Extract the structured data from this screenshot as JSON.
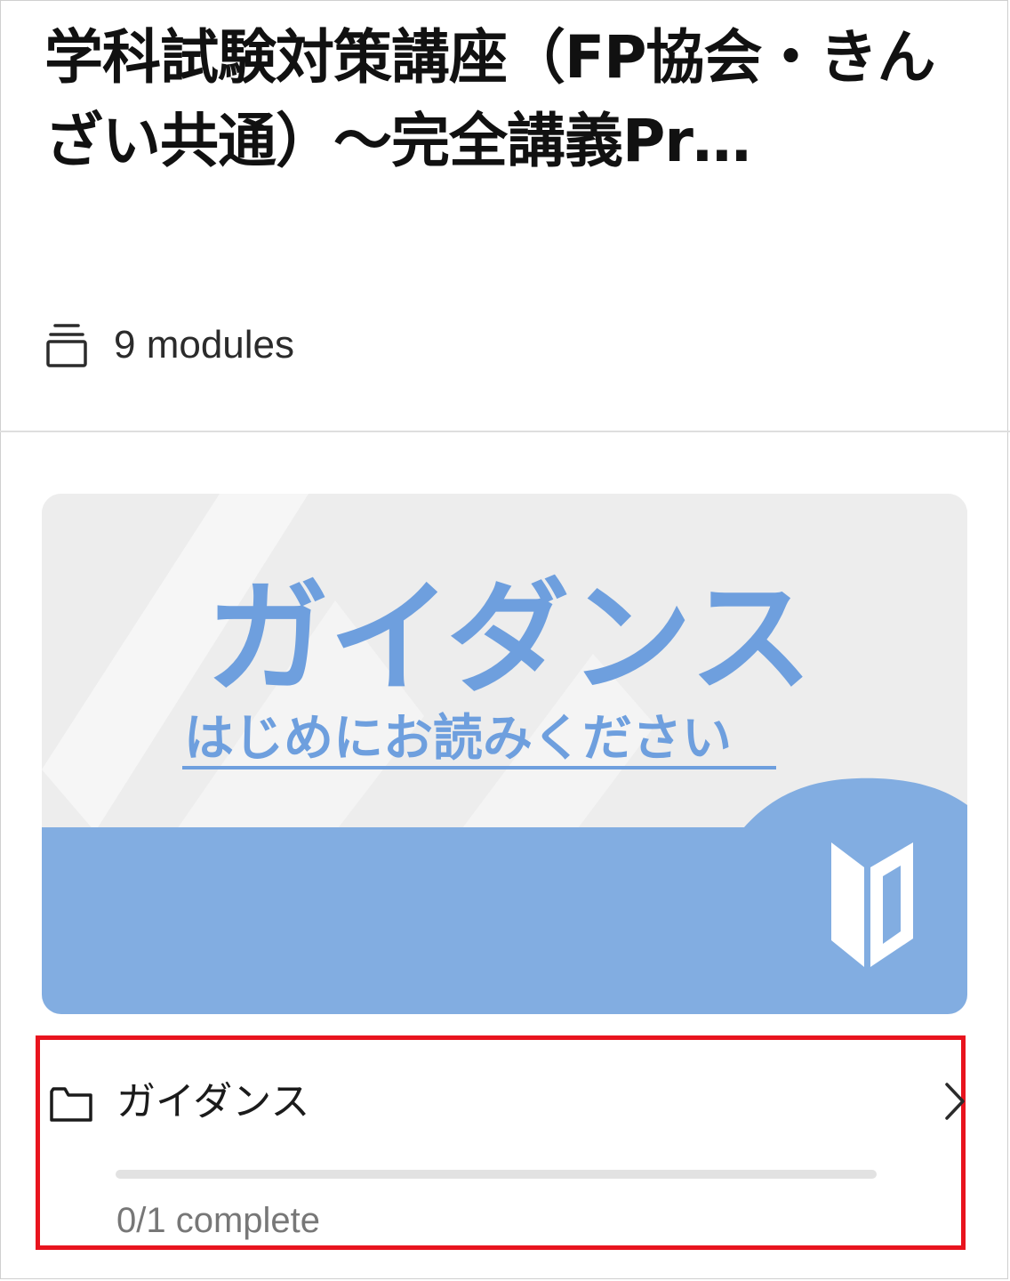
{
  "course": {
    "title": "学科試験対策講座（FP協会・きんざい共通）～完全講義Pr…",
    "modules_count": "9 modules",
    "modules_icon": "stack-icon"
  },
  "module": {
    "thumbnail": {
      "title": "ガイダンス",
      "subtitle": "はじめにお読みください",
      "badge_icon": "beginner-mark-icon",
      "colors": {
        "background": "#ededed",
        "accent": "#6e9fde",
        "band": "#82ade1"
      }
    },
    "name": "ガイダンス",
    "folder_icon": "folder-icon",
    "chevron_icon": "chevron-right-icon",
    "progress_fraction": 0,
    "progress_text": "0/1 complete"
  }
}
